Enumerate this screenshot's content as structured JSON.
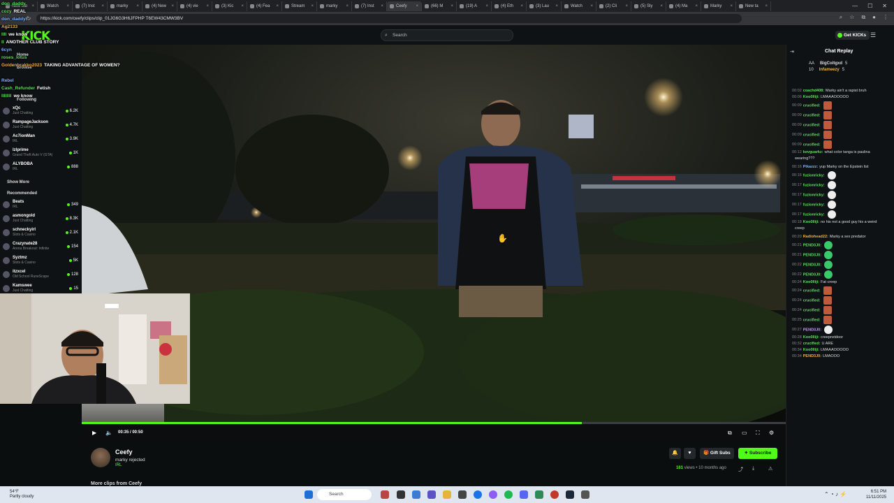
{
  "browser": {
    "tabs": [
      "New tab",
      "Watch",
      "(7) Inst",
      "marky",
      "(4) New",
      "(4) vie",
      "(3) Kic",
      "(4) Fea",
      "Stream",
      "marky",
      "(7) Inst",
      "Ceefy",
      "(66) M",
      "(19) A",
      "(4) Eth",
      "(3) Lau",
      "Watch",
      "(2) Cli",
      "(5) Sly",
      "(4) Ma",
      "Marky",
      "New ta"
    ],
    "active_tab_index": 11,
    "url": "https://kick.com/ceefy/clips/clip_01JG6G3H6JFPHP T6EW43CMW3BV"
  },
  "header": {
    "logo": "KICK",
    "search_placeholder": "Search",
    "get_kicks_label": "Get KICKs"
  },
  "sidebar": {
    "nav": {
      "home": "Home",
      "browse": "Browse",
      "following": "Following"
    },
    "following": [
      {
        "name": "xQc",
        "cat": "Just Chatting",
        "viewers": "6.2K"
      },
      {
        "name": "RampageJackson",
        "cat": "Just Chatting",
        "viewers": "4.7K"
      },
      {
        "name": "Ac7ionMan",
        "cat": "IRL",
        "viewers": "3.9K"
      },
      {
        "name": "lzlprime",
        "cat": "Grand Theft Auto V (GTA)",
        "viewers": "1K"
      },
      {
        "name": "ALYBOBA",
        "cat": "IRL",
        "viewers": "888"
      }
    ],
    "show_more": "Show More",
    "recommended_label": "Recommended",
    "recommended": [
      {
        "name": "Beats",
        "cat": "IRL",
        "viewers": "349"
      },
      {
        "name": "asmongold",
        "cat": "Just Chatting",
        "viewers": "8.3K"
      },
      {
        "name": "schneckyirl",
        "cat": "Slots & Casino",
        "viewers": "2.1K"
      },
      {
        "name": "Crazynate28",
        "cat": "Arena Breakout: Infinite",
        "viewers": "154"
      },
      {
        "name": "Syztmz",
        "cat": "Slots & Casino",
        "viewers": "5K"
      },
      {
        "name": "itzxcel",
        "cat": "Old School RuneScape",
        "viewers": "128"
      },
      {
        "name": "Kamswee",
        "cat": "Just Chatting",
        "viewers": "15"
      }
    ]
  },
  "overlay_chat": [
    {
      "user": "don_daddy",
      "text": ""
    },
    {
      "user": "cozy",
      "text": "REAL"
    },
    {
      "user": "don_daddyt",
      "text": ""
    },
    {
      "user": "Ag2133",
      "text": ""
    },
    {
      "user": "llll",
      "text": "we know"
    },
    {
      "user": "ll",
      "text": "ANOTHER CLUB STORY"
    },
    {
      "user": "6cyn",
      "text": ""
    },
    {
      "user": "roses_lotus",
      "text": ""
    },
    {
      "user": "Goldenbrakko2023",
      "text": "TAKING ADVANTAGE OF WOMEN?"
    },
    {
      "user": "",
      "text": ""
    },
    {
      "user": "Rebel",
      "text": ""
    },
    {
      "user": "Cash_Refunder",
      "text": "Fetish"
    },
    {
      "user": "llllllll",
      "text": "we know"
    }
  ],
  "player": {
    "time": "00:35 / 00:50",
    "progress_fraction": 0.71
  },
  "channel": {
    "name": "Ceefy",
    "clip_title": "marky rejected",
    "category": "IRL",
    "views": "161",
    "views_suffix": "views",
    "age": "10 months ago",
    "more_clips": "More clips from Ceefy",
    "gift_subs_label": "Gift Subs",
    "subscribe_label": "Subscribe"
  },
  "chat": {
    "title": "Chat Replay",
    "leaderboard": [
      {
        "user": "BigColtgxd",
        "count": "5"
      },
      {
        "user": "Infameezy",
        "count": "5"
      }
    ],
    "leaderboard_labels": [
      "AA",
      "10"
    ],
    "messages": [
      {
        "t": "00:02",
        "u": "coachd408:",
        "c": "#5ce15c",
        "m": "Marky ain't a rapist bruh",
        "e": ""
      },
      {
        "t": "00:06",
        "u": "Koo0lliji:",
        "c": "#5ce15c",
        "m": "LMAAAOOOOO",
        "e": ""
      },
      {
        "t": "00:09",
        "u": "crucified:",
        "c": "#5ce15c",
        "m": "",
        "e": "r"
      },
      {
        "t": "00:09",
        "u": "crucified:",
        "c": "#5ce15c",
        "m": "",
        "e": "r"
      },
      {
        "t": "00:09",
        "u": "crucified:",
        "c": "#5ce15c",
        "m": "",
        "e": "r"
      },
      {
        "t": "00:09",
        "u": "crucified:",
        "c": "#5ce15c",
        "m": "",
        "e": "r"
      },
      {
        "t": "00:09",
        "u": "crucified:",
        "c": "#5ce15c",
        "m": "",
        "e": "r"
      },
      {
        "t": "00:12",
        "u": "kevguarkz:",
        "c": "#5ce15c",
        "m": "what color tanga is paulina",
        "e": ""
      },
      {
        "t": "",
        "u": "",
        "c": "#ddd",
        "m": "wearing???",
        "e": ""
      },
      {
        "t": "00:16",
        "u": "Pikazzz:",
        "c": "#7fb3ff",
        "m": "yup Marky on the Epstein list",
        "e": ""
      },
      {
        "t": "00:16",
        "u": "fuzionricky:",
        "c": "#5ce15c",
        "m": "",
        "e": "w"
      },
      {
        "t": "00:17",
        "u": "fuzionricky:",
        "c": "#5ce15c",
        "m": "",
        "e": "w"
      },
      {
        "t": "00:17",
        "u": "fuzionricky:",
        "c": "#5ce15c",
        "m": "",
        "e": "w"
      },
      {
        "t": "00:17",
        "u": "fuzionricky:",
        "c": "#5ce15c",
        "m": "",
        "e": "w"
      },
      {
        "t": "00:17",
        "u": "fuzionricky:",
        "c": "#5ce15c",
        "m": "",
        "e": "w"
      },
      {
        "t": "00:18",
        "u": "Koo0lliji:",
        "c": "#5ce15c",
        "m": "no his not a good guy his a weird",
        "e": ""
      },
      {
        "t": "",
        "u": "",
        "c": "#ddd",
        "m": "creep",
        "e": ""
      },
      {
        "t": "00:20",
        "u": "Radiohead22:",
        "c": "#f5b041",
        "m": "Marky a sex predator",
        "e": ""
      },
      {
        "t": "00:21",
        "u": "PEND3J0:",
        "c": "#5ce15c",
        "m": "",
        "e": "g"
      },
      {
        "t": "00:21",
        "u": "PEND3J0:",
        "c": "#5ce15c",
        "m": "",
        "e": "g"
      },
      {
        "t": "00:22",
        "u": "PEND3J0:",
        "c": "#5ce15c",
        "m": "",
        "e": "g"
      },
      {
        "t": "00:22",
        "u": "PEND3J0:",
        "c": "#5ce15c",
        "m": "",
        "e": "g"
      },
      {
        "t": "00:24",
        "u": "Koo0lliji:",
        "c": "#5ce15c",
        "m": "Fat creep",
        "e": ""
      },
      {
        "t": "00:24",
        "u": "crucified:",
        "c": "#5ce15c",
        "m": "",
        "e": "r"
      },
      {
        "t": "00:24",
        "u": "crucified:",
        "c": "#5ce15c",
        "m": "",
        "e": "r"
      },
      {
        "t": "00:24",
        "u": "crucified:",
        "c": "#5ce15c",
        "m": "",
        "e": "r"
      },
      {
        "t": "00:25",
        "u": "crucified:",
        "c": "#5ce15c",
        "m": "",
        "e": "r"
      },
      {
        "t": "00:27",
        "u": "PEND3J0:",
        "c": "#c59bff",
        "m": "",
        "e": "w"
      },
      {
        "t": "00:28",
        "u": "Koo0lliji:",
        "c": "#5ce15c",
        "m": "creepnxtdoor",
        "e": ""
      },
      {
        "t": "00:32",
        "u": "crucified:",
        "c": "#5ce15c",
        "m": "U ARE",
        "e": ""
      },
      {
        "t": "00:34",
        "u": "Koo0lliji:",
        "c": "#5ce15c",
        "m": "LMAAAOOOOO",
        "e": ""
      },
      {
        "t": "00:34",
        "u": "PEND3J0:",
        "c": "#f5b041",
        "m": "LMAOOO",
        "e": ""
      }
    ]
  },
  "taskbar": {
    "weather_temp": "54°F",
    "weather_desc": "Partly cloudy",
    "search_label": "Search",
    "time": "6:51 PM",
    "date": "11/11/2025"
  },
  "colors": {
    "accent": "#53fc18",
    "bg": "#0b0e0f"
  }
}
